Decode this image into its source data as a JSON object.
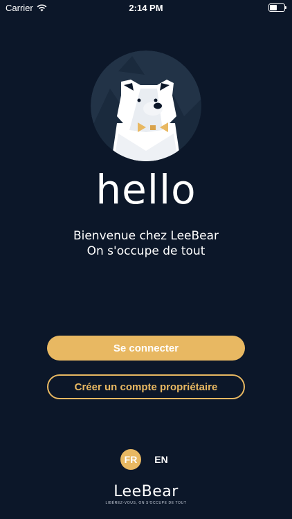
{
  "status_bar": {
    "carrier": "Carrier",
    "time": "2:14 PM",
    "battery_level": 0.5,
    "wifi_icon": "wifi-icon",
    "battery_icon": "battery-icon"
  },
  "hero": {
    "title": "hello",
    "welcome_line1": "Bienvenue chez LeeBear",
    "welcome_line2": "On s'occupe de tout"
  },
  "actions": {
    "login_label": "Se connecter",
    "create_account_label": "Créer un compte propriétaire"
  },
  "language": {
    "options": [
      "FR",
      "EN"
    ],
    "selected": "FR"
  },
  "brand": {
    "logo": "LeeBear",
    "tagline": "LIBÉREZ-VOUS, ON S'OCCUPE DE TOUT"
  },
  "colors": {
    "background": "#0c1729",
    "accent": "#e8b862",
    "bear_bg": "#223347"
  }
}
